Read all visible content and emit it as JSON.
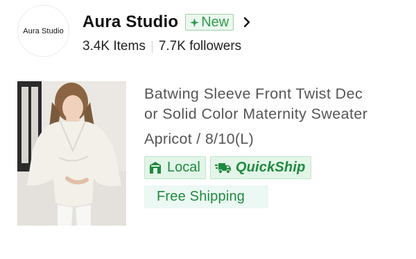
{
  "store": {
    "logo_text": "Aura Studio",
    "name": "Aura Studio",
    "badge_label": "New",
    "items_count": "3.4K Items",
    "followers_count": "7.7K followers"
  },
  "product": {
    "title_line1": "Batwing Sleeve Front Twist Dec",
    "title_line2": "or Solid Color Maternity Sweater",
    "variant": "Apricot / 8/10(L)",
    "tags": [
      {
        "label": "Local",
        "icon": "store-icon"
      },
      {
        "label": "QuickShip",
        "icon": "truck-icon"
      }
    ],
    "shipping_label": "Free Shipping"
  },
  "colors": {
    "accent_green": "#1e8a3e",
    "badge_green": "#2f9a4b",
    "tag_background": "#e3f5e8",
    "shipping_background": "#ecf8f3",
    "text_primary": "#111111",
    "text_secondary": "#555555"
  },
  "icons": [
    "sparkle-icon",
    "chevron-right-icon",
    "store-icon",
    "truck-icon"
  ]
}
